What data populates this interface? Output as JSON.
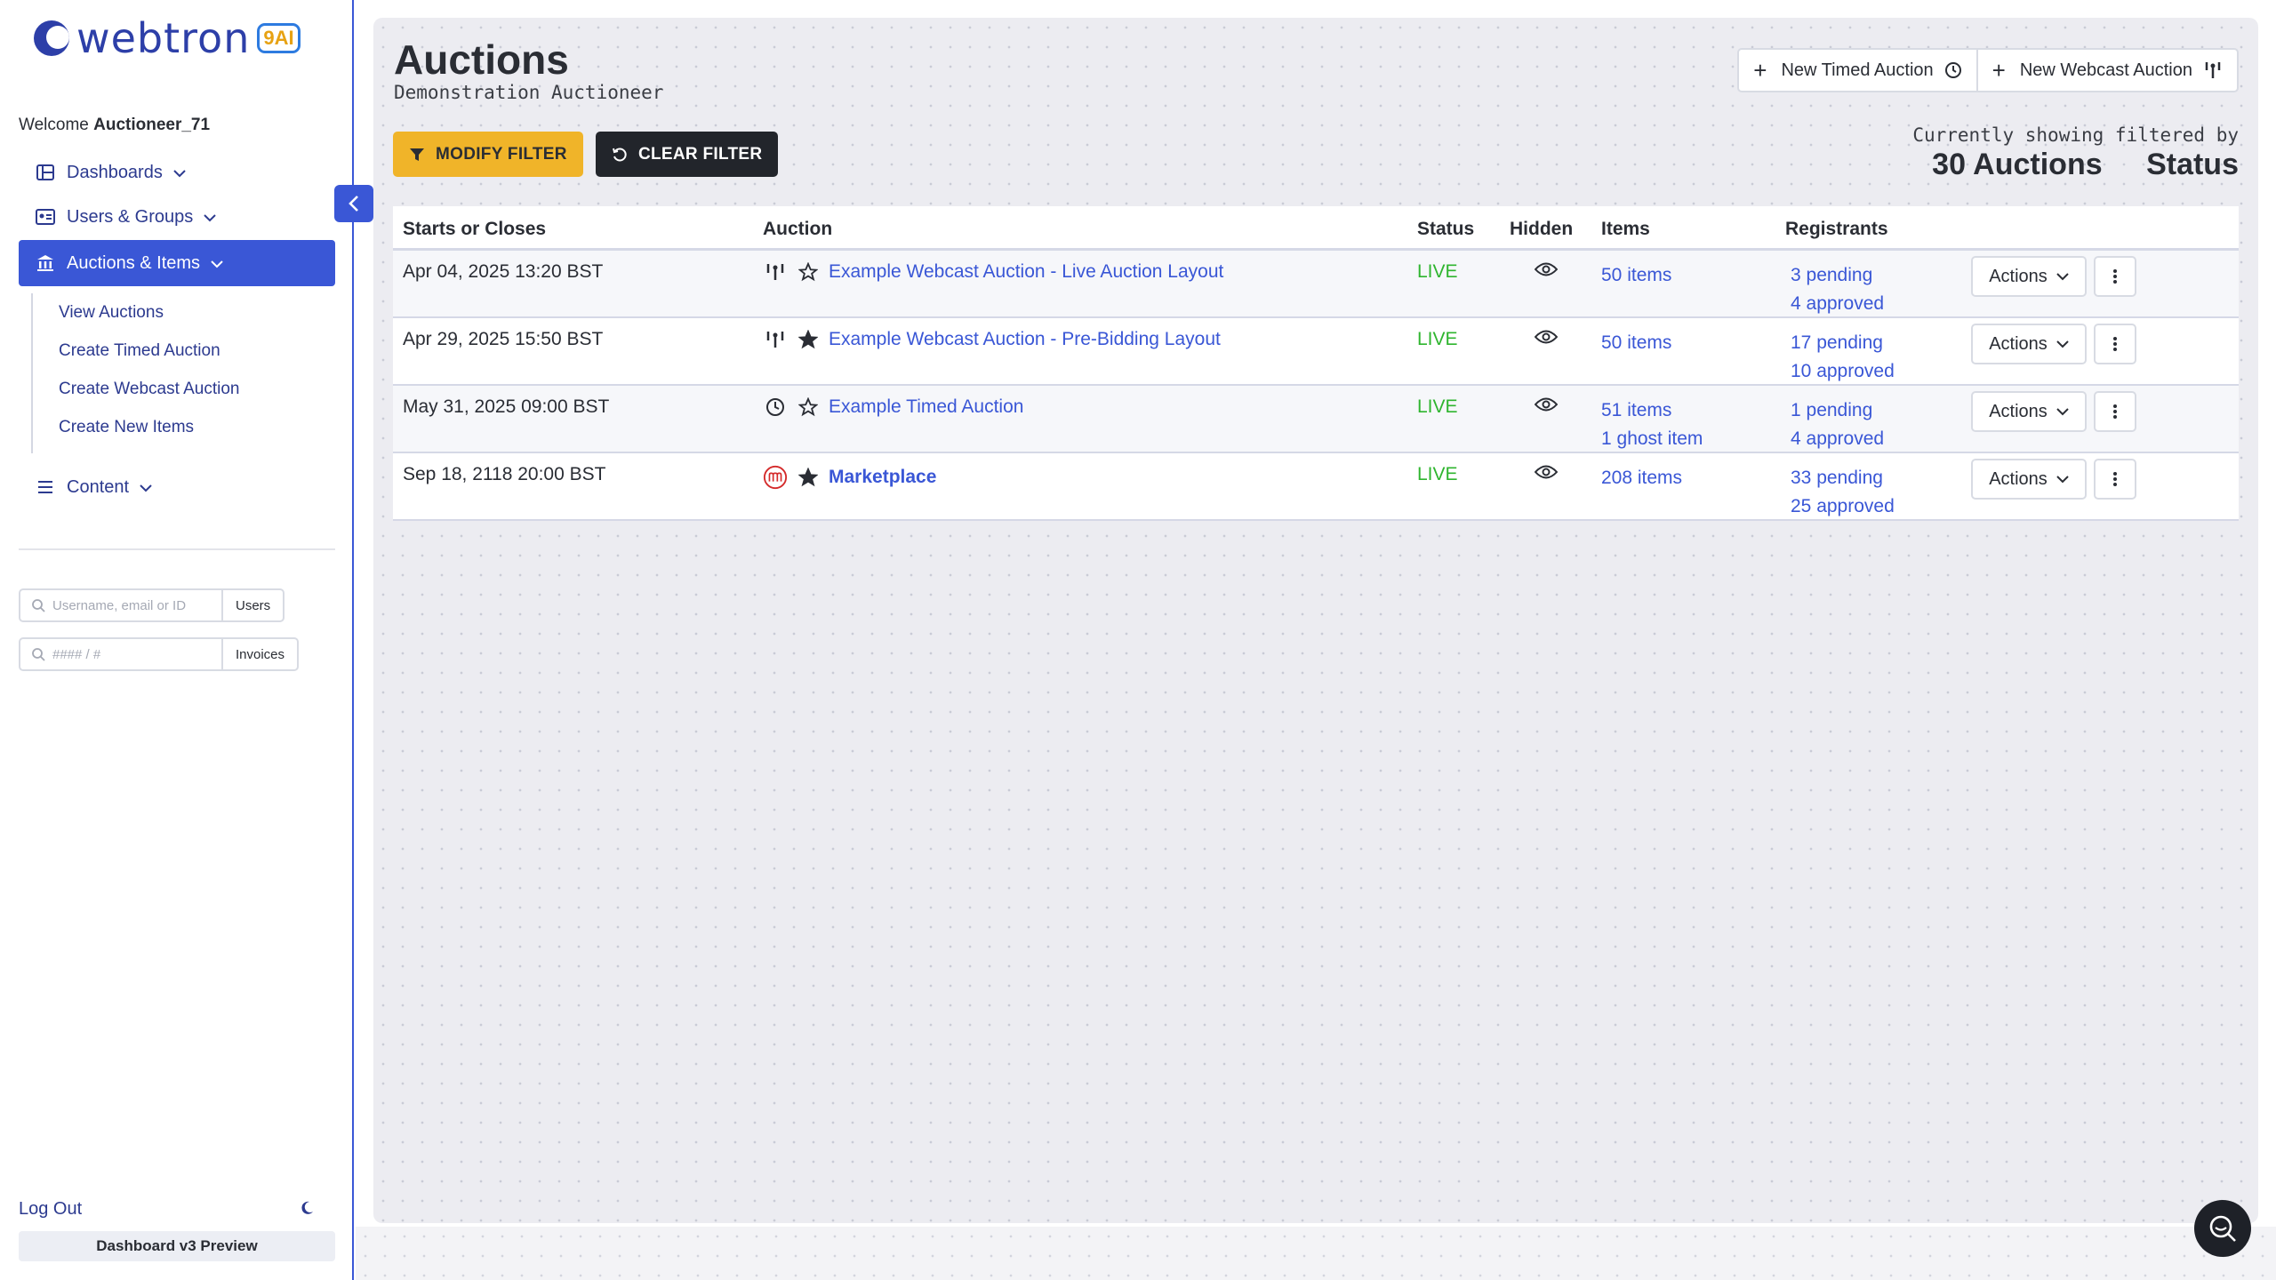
{
  "brand": {
    "name": "webtron",
    "badge": "9AI"
  },
  "sidebar": {
    "welcome_prefix": "Welcome",
    "username": "Auctioneer_71",
    "nav": [
      {
        "label": "Dashboards",
        "icon": "dashboard-icon"
      },
      {
        "label": "Users & Groups",
        "icon": "users-icon"
      },
      {
        "label": "Auctions & Items",
        "icon": "bank-icon"
      },
      {
        "label": "Content",
        "icon": "menu-lines-icon"
      }
    ],
    "subnav": [
      "View Auctions",
      "Create Timed Auction",
      "Create Webcast Auction",
      "Create New Items"
    ],
    "user_search": {
      "placeholder": "Username, email or ID",
      "button": "Users"
    },
    "invoice_search": {
      "placeholder": "#### / #",
      "button": "Invoices"
    },
    "logout": "Log Out",
    "preview": "Dashboard v3 Preview"
  },
  "page": {
    "title": "Auctions",
    "subtitle": "Demonstration Auctioneer",
    "new_timed": "New Timed Auction",
    "new_webcast": "New Webcast Auction",
    "modify_filter": "MODIFY FILTER",
    "clear_filter": "CLEAR FILTER",
    "showing_label": "Currently showing filtered by",
    "count": "30 Auctions",
    "filter_by": "Status"
  },
  "table": {
    "headers": [
      "Starts or Closes",
      "Auction",
      "Status",
      "Hidden",
      "Items",
      "Registrants"
    ],
    "action_label": "Actions",
    "rows": [
      {
        "date": "Apr 04, 2025 13:20 BST",
        "type": "webcast",
        "starred": false,
        "name": "Example Webcast Auction - Live Auction Layout",
        "status": "LIVE",
        "items": "50 items",
        "items2": "",
        "pending": "3 pending",
        "approved": "4 approved"
      },
      {
        "date": "Apr 29, 2025 15:50 BST",
        "type": "webcast",
        "starred": true,
        "name": "Example Webcast Auction - Pre-Bidding Layout",
        "status": "LIVE",
        "items": "50 items",
        "items2": "",
        "pending": "17 pending",
        "approved": "10 approved"
      },
      {
        "date": "May 31, 2025 09:00 BST",
        "type": "timed",
        "starred": false,
        "name": "Example Timed Auction",
        "status": "LIVE",
        "items": "51 items",
        "items2": "1 ghost item",
        "pending": "1 pending",
        "approved": "4 approved"
      },
      {
        "date": "Sep 18, 2118 20:00 BST",
        "type": "marketplace",
        "starred": true,
        "name": "Marketplace",
        "status": "LIVE",
        "items": "208 items",
        "items2": "",
        "pending": "33 pending",
        "approved": "25 approved"
      }
    ]
  },
  "colors": {
    "accent": "#3a57d6",
    "warning": "#f0b429",
    "live": "#2fb52f",
    "dark": "#22252b"
  }
}
